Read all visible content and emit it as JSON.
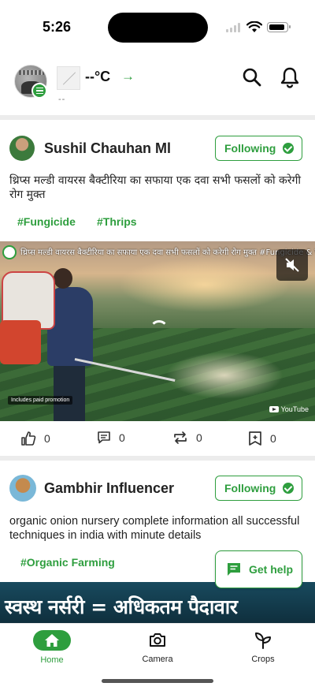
{
  "status_bar": {
    "time": "5:26"
  },
  "header": {
    "temperature": "--°C",
    "temperature_arrow": "→",
    "temperature_subtext": "--",
    "icons": [
      "menu-icon",
      "search-icon",
      "bell-icon"
    ]
  },
  "posts": [
    {
      "author": "Sushil Chauhan Ml",
      "follow_label": "Following",
      "text": "थ्रिप्स मल्डी वायरस बैक्टीरिया का सफाया एक दवा सभी फसलों को करेगी रोग मुक्त",
      "tags": [
        "#Fungicide",
        "#Thrips"
      ],
      "video_title": "थ्रिप्स मल्डी वायरस बैक्टीरिया का सफाया एक दवा सभी फसलों को करेगी रोग मुक्त #Fungicide & Virus G",
      "promo_label": "Includes paid promotion",
      "video_source": "YouTube",
      "actions": {
        "likes": "0",
        "comments": "0",
        "shares": "0",
        "saves": "0"
      }
    },
    {
      "author": "Gambhir Influencer",
      "follow_label": "Following",
      "text": "organic onion nursery complete information all successful techniques in india with minute details",
      "tags": [
        "#Organic Farming"
      ],
      "banner_text": "स्वस्थ नर्सरी = अधिकतम पैदावार"
    }
  ],
  "help_button": {
    "label": "Get help"
  },
  "bottom_nav": {
    "items": [
      {
        "label": "Home",
        "active": true
      },
      {
        "label": "Camera",
        "active": false
      },
      {
        "label": "Crops",
        "active": false
      }
    ]
  },
  "colors": {
    "accent": "#2e9e3e",
    "divider": "#ececec"
  }
}
